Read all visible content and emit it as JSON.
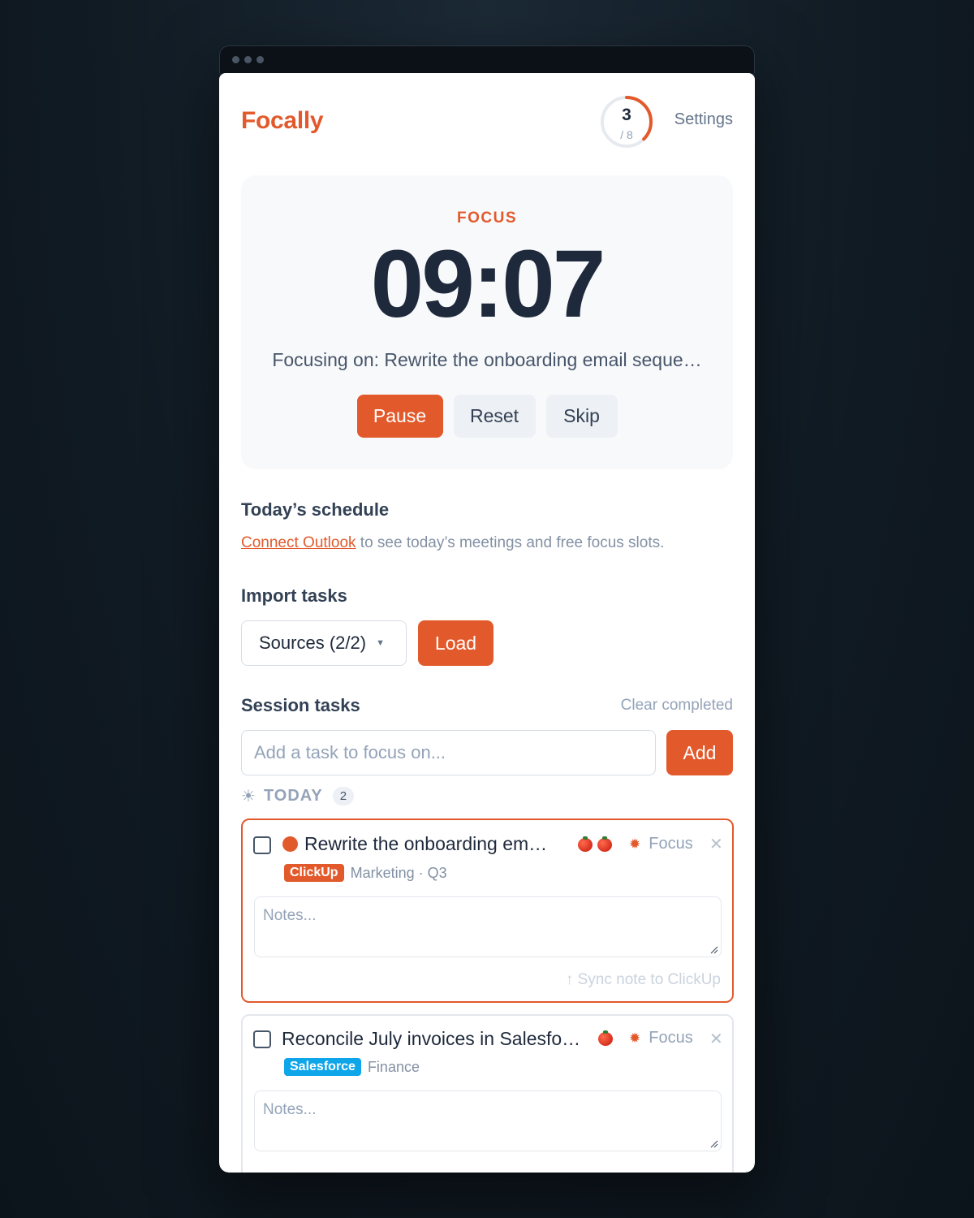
{
  "app": {
    "name": "Focally",
    "settings_label": "Settings"
  },
  "progress": {
    "completed": "3",
    "total_label": "/ 8",
    "completed_value": 3,
    "total_value": 8
  },
  "timer": {
    "mode": "FOCUS",
    "time": "09:07",
    "focusing_on": "Focusing on: Rewrite the onboarding email seque…",
    "buttons": {
      "pause": "Pause",
      "reset": "Reset",
      "skip": "Skip"
    }
  },
  "schedule": {
    "title": "Today’s schedule",
    "connect_link": "Connect Outlook",
    "note": " to see today’s meetings and free focus slots."
  },
  "import": {
    "title": "Import tasks",
    "sources": "Sources (2/2)",
    "load": "Load"
  },
  "session": {
    "title": "Session tasks",
    "clear_completed": "Clear completed",
    "input_placeholder": "Add a task to focus on...",
    "add": "Add",
    "group": {
      "label": "TODAY",
      "count": "2"
    },
    "tasks": [
      {
        "title": "Rewrite the onboarding em…",
        "pomodoros": 2,
        "focus_label": "Focus",
        "source": "ClickUp",
        "source_color": "#e25a2c",
        "meta": "Marketing · Q3",
        "notes_placeholder": "Notes...",
        "sync_label": "↑ Sync note to ClickUp",
        "active": true
      },
      {
        "title": "Reconcile July invoices in Salesfo…",
        "pomodoros": 1,
        "focus_label": "Focus",
        "source": "Salesforce",
        "source_color": "#0ea5e9",
        "meta": "Finance",
        "notes_placeholder": "Notes...",
        "active": false
      }
    ]
  },
  "colors": {
    "accent": "#e25a2c",
    "text": "#1e293b",
    "muted": "#94a3b8"
  },
  "icons": [
    "sun-icon",
    "close-icon",
    "tomato-icon",
    "caret-down-icon",
    "resize-grip-icon"
  ]
}
